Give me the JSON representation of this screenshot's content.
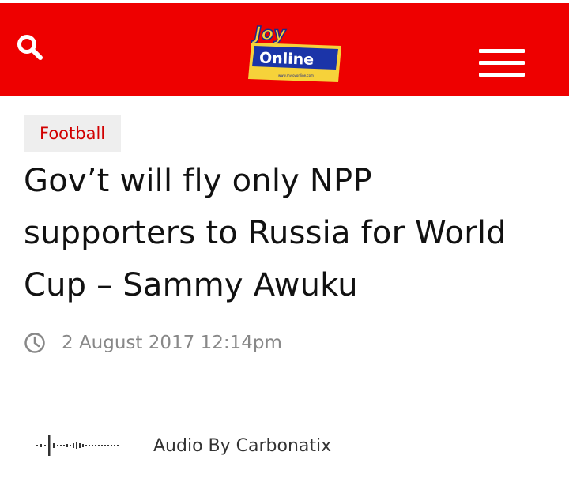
{
  "header": {
    "logo": {
      "top_text": "Joy",
      "main_text": "Online",
      "sub_text": "www.myjoyonline.com"
    },
    "brand_color": "#ee0000",
    "search_icon": "search-icon",
    "menu_icon": "hamburger-menu-icon"
  },
  "article": {
    "category": "Football",
    "title": "Gov’t will fly only NPP supporters to Russia for World Cup – Sammy Awuku",
    "date": "2 August 2017 12:14pm",
    "audio_credit": "Audio By Carbonatix"
  }
}
